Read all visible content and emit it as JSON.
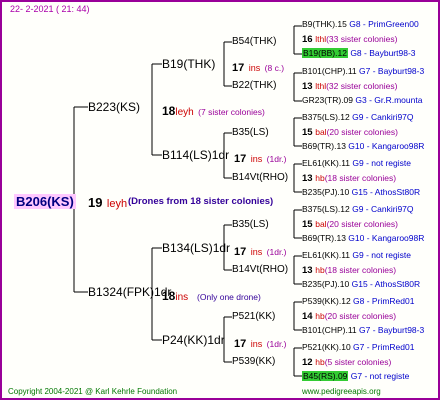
{
  "date": "22-  2-2021  ( 21: 44)",
  "tree": {
    "root": {
      "id": "B206(KS)",
      "num": "19",
      "ins": "leyh",
      "note": "(Drones from 18 sister colonies)"
    },
    "l1": [
      {
        "id": "B223(KS)",
        "num": "18",
        "ins": "leyh",
        "sis": "(7 sister colonies)"
      },
      {
        "id": "B1324(FPK)1dr",
        "num": "18",
        "ins": "ins",
        "sis": "(Only one drone)"
      }
    ],
    "l2": [
      {
        "id": "B19(THK)",
        "num": "17",
        "ins": "ins",
        "sis": "(8 c.)"
      },
      {
        "id": "B114(LS)1dr",
        "num": "17",
        "ins": "ins",
        "sis": "(1dr.)"
      },
      {
        "id": "B134(LS)1dr",
        "num": "17",
        "ins": "ins",
        "sis": "(1dr.)"
      },
      {
        "id": "P24(KK)1dr",
        "num": "17",
        "ins": "ins",
        "sis": "(1dr.)"
      }
    ],
    "l3": [
      "B54(THK)",
      "B22(THK)",
      "B35(LS)",
      "B14Vt(RHO)",
      "B35(LS)",
      "B14Vt(RHO)",
      "P521(KK)",
      "P539(KK)"
    ],
    "l4": [
      {
        "kind": "q",
        "id": "B9(THK).15",
        "bee": "G8 - PrimGreen00",
        "hi": false
      },
      {
        "kind": "s",
        "num": "16",
        "ins": "lthl",
        "sis": "(33 sister colonies)"
      },
      {
        "kind": "q",
        "id": "B19(BB).12",
        "bee": "G8 - Bayburt98-3",
        "hi": true
      },
      {
        "kind": "q",
        "id": "B101(CHP).11",
        "bee": "G7 - Bayburt98-3",
        "hi": false
      },
      {
        "kind": "s",
        "num": "13",
        "ins": "lthl",
        "sis": "(32 sister colonies)"
      },
      {
        "kind": "q",
        "id": "GR23(TR).09",
        "bee": "G3 - Gr.R.mounta",
        "hi": false
      },
      {
        "kind": "q",
        "id": "B375(LS).12",
        "bee": "G9 - Cankiri97Q",
        "hi": false
      },
      {
        "kind": "s",
        "num": "15",
        "ins": "bal",
        "sis": "(20 sister colonies)"
      },
      {
        "kind": "q",
        "id": "B69(TR).13",
        "bee": "G10 - Kangaroo98R",
        "hi": false
      },
      {
        "kind": "q",
        "id": "EL61(KK).11",
        "bee": "G9 - not registe",
        "hi": false
      },
      {
        "kind": "s",
        "num": "13",
        "ins": "hb",
        "sis": "(18 sister colonies)"
      },
      {
        "kind": "q",
        "id": "B235(PJ).10",
        "bee": "G15 - AthosSt80R",
        "hi": false
      },
      {
        "kind": "q",
        "id": "B375(LS).12",
        "bee": "G9 - Cankiri97Q",
        "hi": false
      },
      {
        "kind": "s",
        "num": "15",
        "ins": "bal",
        "sis": "(20 sister colonies)"
      },
      {
        "kind": "q",
        "id": "B69(TR).13",
        "bee": "G10 - Kangaroo98R",
        "hi": false
      },
      {
        "kind": "q",
        "id": "EL61(KK).11",
        "bee": "G9 - not registe",
        "hi": false
      },
      {
        "kind": "s",
        "num": "13",
        "ins": "hb",
        "sis": "(18 sister colonies)"
      },
      {
        "kind": "q",
        "id": "B235(PJ).10",
        "bee": "G15 - AthosSt80R",
        "hi": false
      },
      {
        "kind": "q",
        "id": "P539(KK).12",
        "bee": "G8 - PrimRed01",
        "hi": false
      },
      {
        "kind": "s",
        "num": "14",
        "ins": "hb",
        "sis": "(20 sister colonies)"
      },
      {
        "kind": "q",
        "id": "B101(CHP).11",
        "bee": "G7 - Bayburt98-3",
        "hi": false
      },
      {
        "kind": "q",
        "id": "P521(KK).10",
        "bee": "G7 - PrimRed01",
        "hi": false
      },
      {
        "kind": "s",
        "num": "12",
        "ins": "hb",
        "sis": "(5 sister colonies)"
      },
      {
        "kind": "q",
        "id": "B45(RS).09",
        "bee": "G7 - not registe",
        "hi": true
      }
    ]
  },
  "footer": {
    "copyright": "Copyright 2004-2021 @ Karl Kehrle Foundation",
    "site": "www.pedigreeapis.org"
  }
}
